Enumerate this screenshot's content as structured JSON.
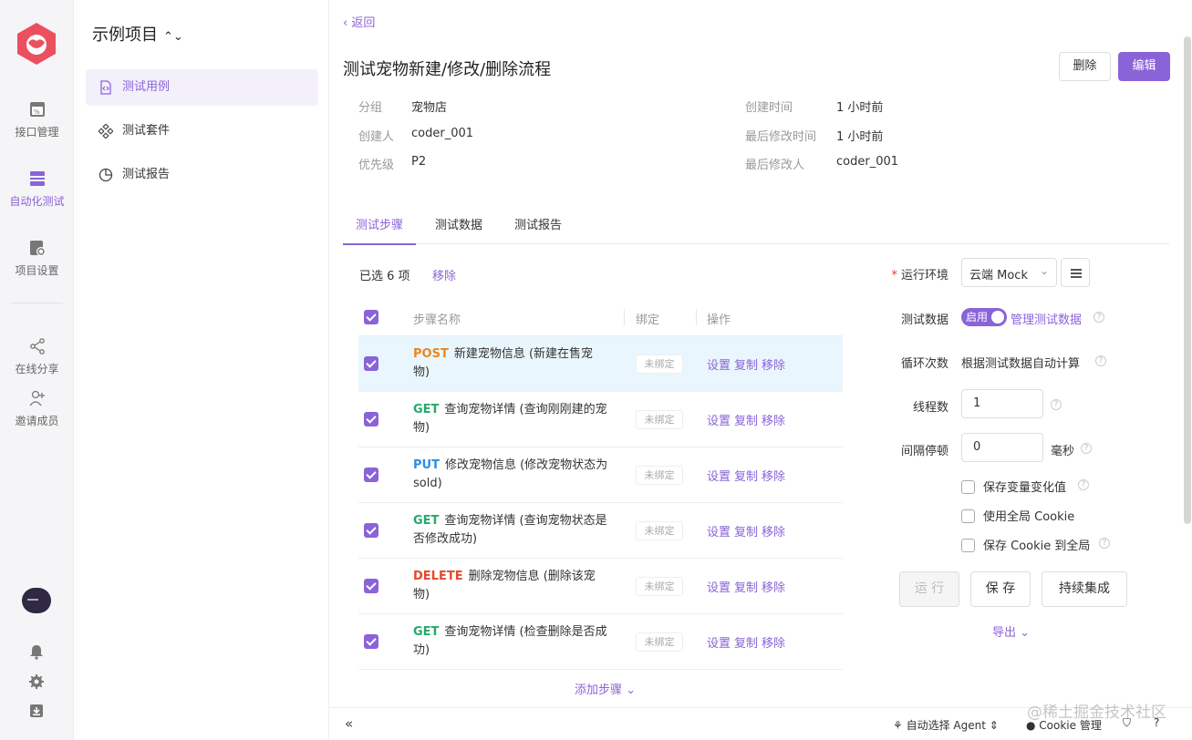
{
  "rail": {
    "items": [
      {
        "label": "接口管理",
        "icon": "api-icon"
      },
      {
        "label": "自动化测试",
        "icon": "automation-icon"
      },
      {
        "label": "项目设置",
        "icon": "settings-doc-icon"
      },
      {
        "label": "在线分享",
        "icon": "share-icon"
      },
      {
        "label": "邀请成员",
        "icon": "add-user-icon"
      }
    ]
  },
  "sidebar": {
    "project_title": "示例项目",
    "items": [
      {
        "label": "测试用例"
      },
      {
        "label": "测试套件"
      },
      {
        "label": "测试报告"
      }
    ]
  },
  "main": {
    "back": "返回",
    "title": "测试宠物新建/修改/删除流程",
    "delete_label": "删除",
    "edit_label": "编辑",
    "meta": {
      "group_label": "分组",
      "group_value": "宠物店",
      "creator_label": "创建人",
      "creator_value": "coder_001",
      "priority_label": "优先级",
      "priority_value": "P2",
      "created_label": "创建时间",
      "created_value": "1 小时前",
      "modified_label": "最后修改时间",
      "modified_value": "1 小时前",
      "modifier_label": "最后修改人",
      "modifier_value": "coder_001"
    },
    "tabs": [
      {
        "label": "测试步骤"
      },
      {
        "label": "测试数据"
      },
      {
        "label": "测试报告"
      }
    ],
    "selected_count": "已选 6 项",
    "remove_selected": "移除",
    "table": {
      "headers": {
        "name": "步骤名称",
        "bind": "绑定",
        "ops": "操作"
      },
      "bind_tag": "未绑定",
      "ops": {
        "settings": "设置",
        "copy": "复制",
        "remove": "移除"
      },
      "rows": [
        {
          "method": "POST",
          "method_color": "#e8871f",
          "desc": "新建宠物信息 (新建在售宠物)"
        },
        {
          "method": "GET",
          "method_color": "#26a86b",
          "desc": "查询宠物详情 (查询刚刚建的宠物)"
        },
        {
          "method": "PUT",
          "method_color": "#2b8ee5",
          "desc": "修改宠物信息 (修改宠物状态为 sold)"
        },
        {
          "method": "GET",
          "method_color": "#26a86b",
          "desc": "查询宠物详情 (查询宠物状态是否修改成功)"
        },
        {
          "method": "DELETE",
          "method_color": "#e5482b",
          "desc": "删除宠物信息 (删除该宠物)"
        },
        {
          "method": "GET",
          "method_color": "#26a86b",
          "desc": "查询宠物详情 (检查删除是否成功)"
        }
      ]
    },
    "add_step": "添加步骤"
  },
  "config": {
    "env_label": "运行环境",
    "env_value": "云端 Mock",
    "data_label": "测试数据",
    "data_toggle": "启用",
    "data_manage": "管理测试数据",
    "loop_label": "循环次数",
    "loop_value": "根据测试数据自动计算",
    "threads_label": "线程数",
    "threads_value": "1",
    "interval_label": "间隔停顿",
    "interval_value": "0",
    "interval_unit": "毫秒",
    "opt_save_var": "保存变量变化值",
    "opt_global_cookie": "使用全局 Cookie",
    "opt_save_cookie": "保存 Cookie 到全局",
    "run": "运 行",
    "save": "保 存",
    "ci": "持续集成",
    "export": "导出"
  },
  "bottom": {
    "collapse": "«",
    "agent": "自动选择 Agent",
    "cookie": "Cookie 管理"
  },
  "watermark": "@稀土掘金技术社区",
  "colors": {
    "accent": "#8b63d8"
  }
}
